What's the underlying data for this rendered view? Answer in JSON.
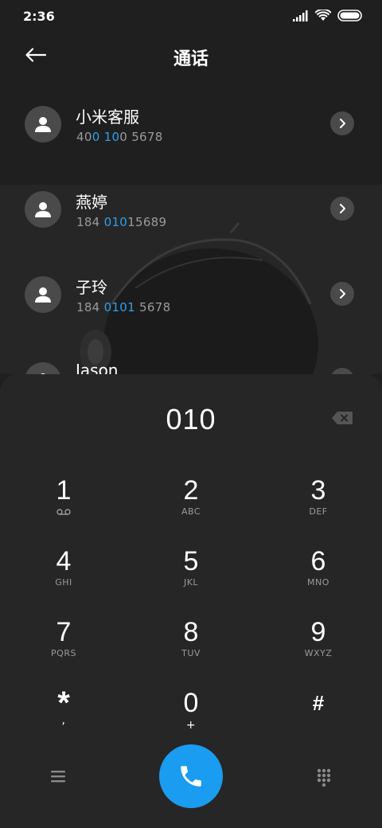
{
  "status": {
    "time": "2:36"
  },
  "header": {
    "title": "通话"
  },
  "contacts": [
    {
      "name": "小米客服",
      "number_parts": [
        "40",
        "0",
        " ",
        "10",
        "0 5678"
      ]
    },
    {
      "name": "燕婷",
      "number_parts": [
        "184 ",
        "010",
        "15689"
      ]
    },
    {
      "name": "子玲",
      "number_parts": [
        "184 ",
        "0101",
        " 5678"
      ]
    },
    {
      "name": "Jason"
    }
  ],
  "dialpad": {
    "input": "010",
    "keys": [
      {
        "digit": "1",
        "letters": ""
      },
      {
        "digit": "2",
        "letters": "ABC"
      },
      {
        "digit": "3",
        "letters": "DEF"
      },
      {
        "digit": "4",
        "letters": "GHI"
      },
      {
        "digit": "5",
        "letters": "JKL"
      },
      {
        "digit": "6",
        "letters": "MNO"
      },
      {
        "digit": "7",
        "letters": "PQRS"
      },
      {
        "digit": "8",
        "letters": "TUV"
      },
      {
        "digit": "9",
        "letters": "WXYZ"
      },
      {
        "digit": "*",
        "letters": ","
      },
      {
        "digit": "0",
        "letters": "+"
      },
      {
        "digit": "#",
        "letters": ""
      }
    ]
  },
  "icons": {
    "back": "back-arrow-icon",
    "call": "phone-icon",
    "menu": "menu-icon",
    "keypad": "dialpad-icon",
    "backspace": "backspace-icon",
    "voicemail": "voicemail-icon"
  },
  "colors": {
    "accent": "#1a9cf0",
    "highlight": "#2ca0ee"
  }
}
